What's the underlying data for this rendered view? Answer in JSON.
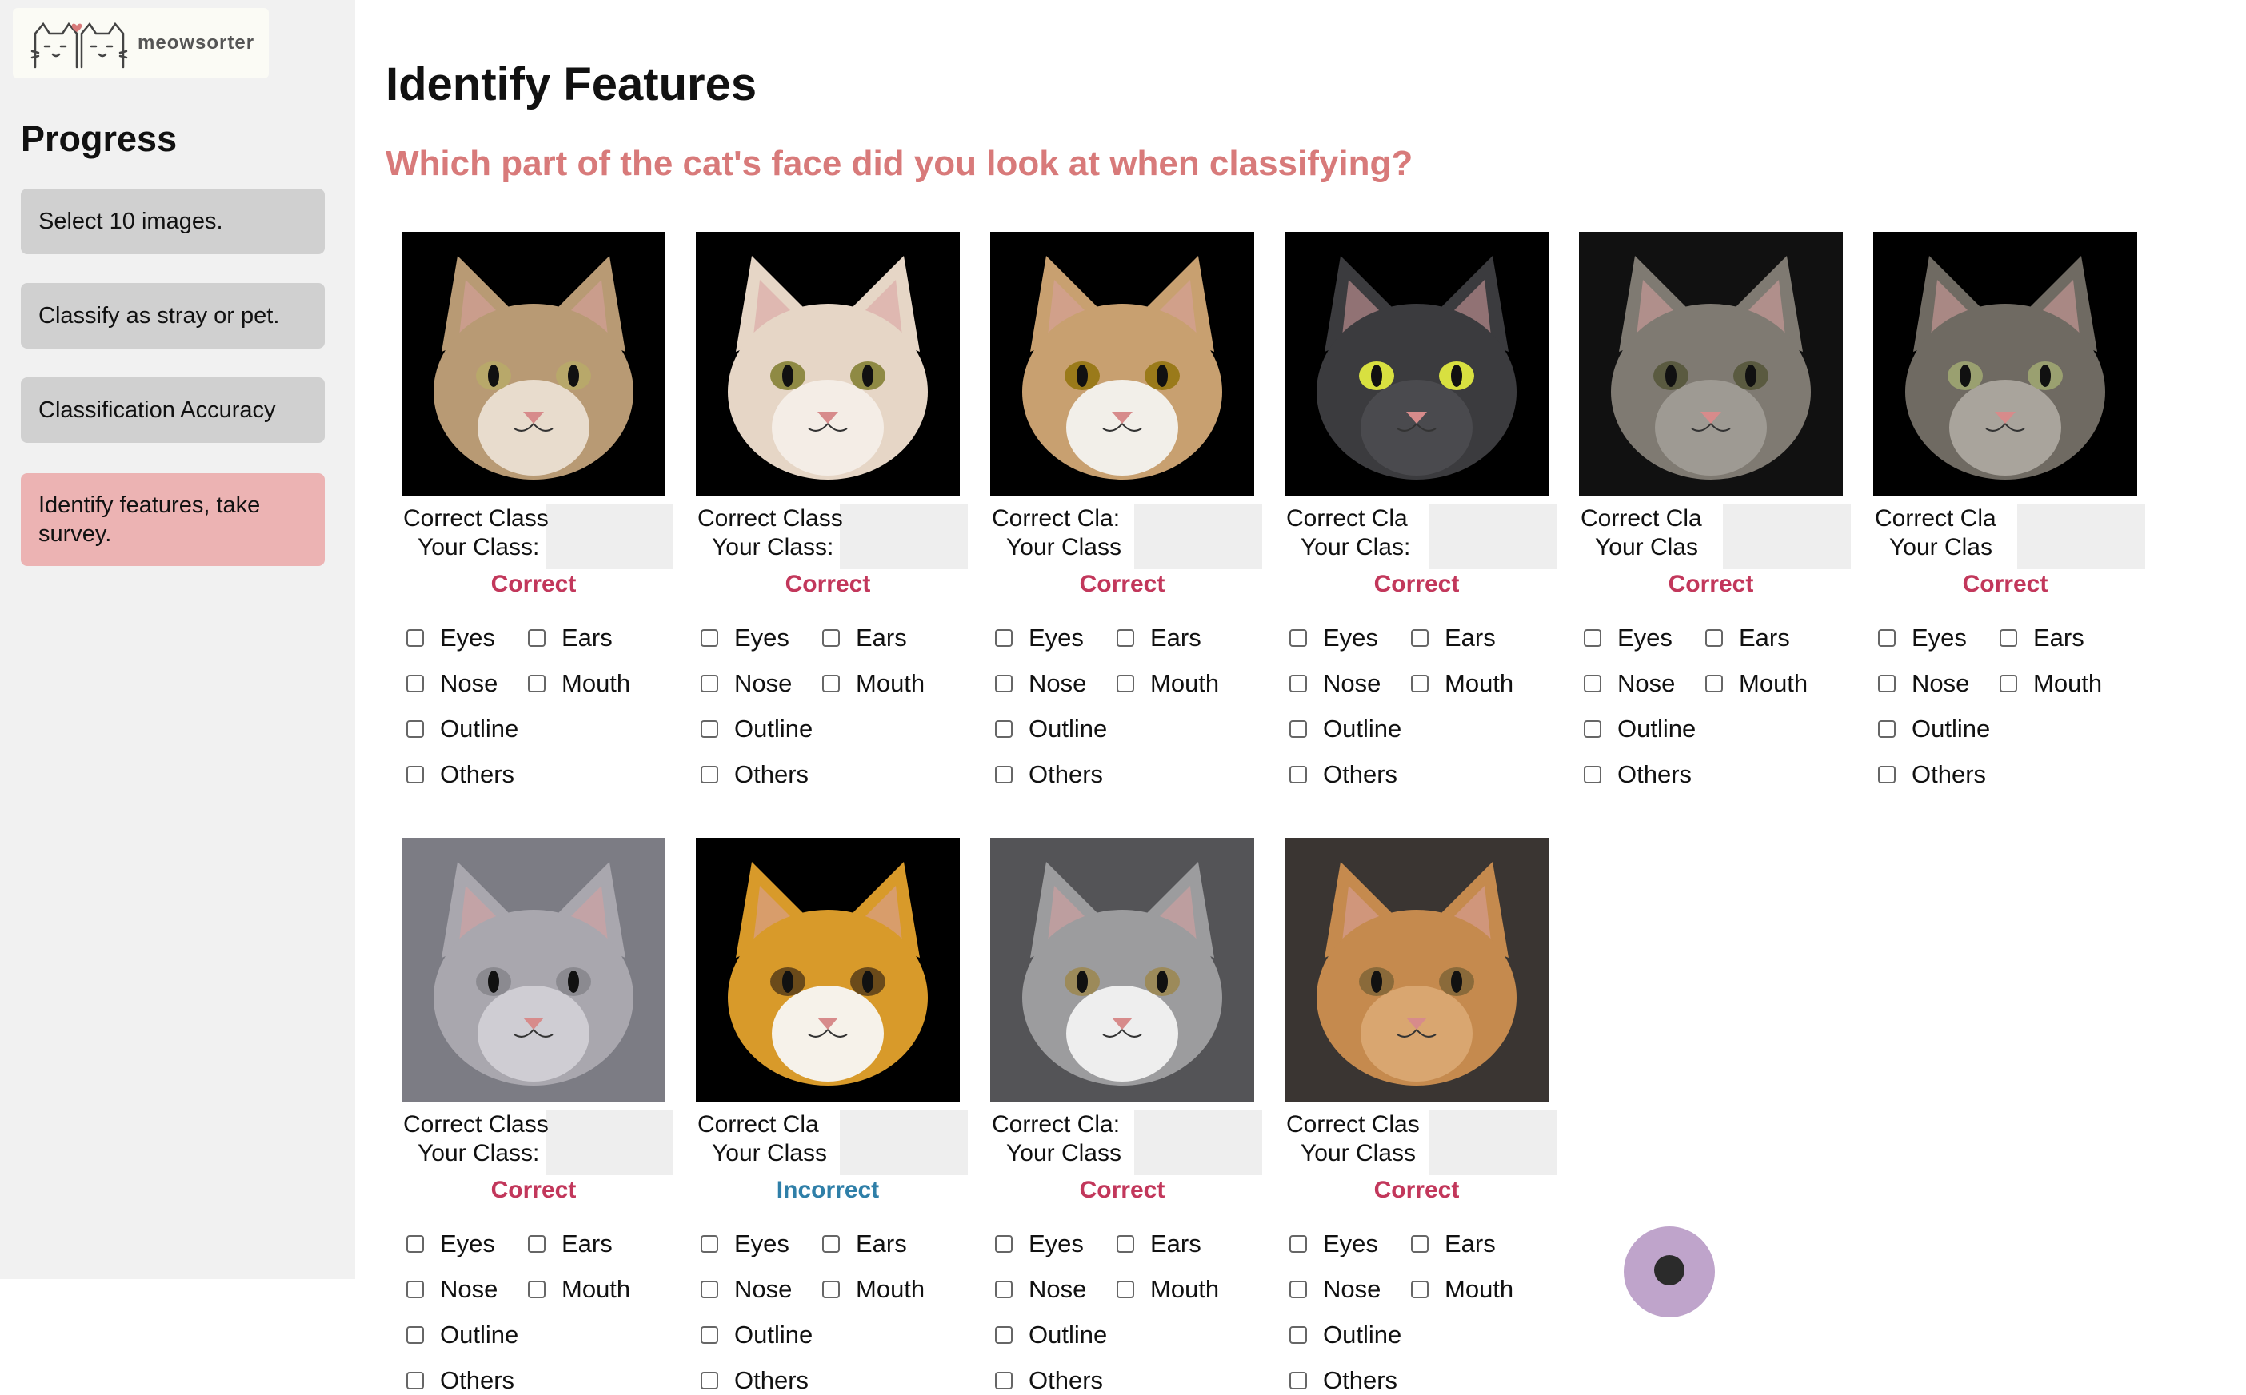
{
  "brand": {
    "name": "meowsorter"
  },
  "sidebar": {
    "title": "Progress",
    "steps": [
      {
        "label": "Select 10 images."
      },
      {
        "label": "Classify as stray or pet."
      },
      {
        "label": "Classification Accuracy"
      },
      {
        "label": "Identify features, take survey.",
        "active": true
      }
    ]
  },
  "page": {
    "title": "Identify Features",
    "question": "Which part of the cat's face did you look at when classifying?"
  },
  "checkbox_labels": {
    "eyes": "Eyes",
    "ears": "Ears",
    "nose": "Nose",
    "mouth": "Mouth",
    "outline": "Outline",
    "others": "Others"
  },
  "cards": [
    {
      "correct_class": "Correct Class",
      "your_class": "Your Class:",
      "result": "Correct"
    },
    {
      "correct_class": "Correct Class",
      "your_class": "Your Class:",
      "result": "Correct"
    },
    {
      "correct_class": "Correct Cla:",
      "your_class": "Your Class",
      "result": "Correct"
    },
    {
      "correct_class": "Correct Cla",
      "your_class": "Your Clas:",
      "result": "Correct"
    },
    {
      "correct_class": "Correct Cla",
      "your_class": "Your Clas",
      "result": "Correct"
    },
    {
      "correct_class": "Correct Cla",
      "your_class": "Your Clas",
      "result": "Correct"
    },
    {
      "correct_class": "Correct Class",
      "your_class": "Your Class:",
      "result": "Correct"
    },
    {
      "correct_class": "Correct Cla",
      "your_class": "Your Class",
      "result": "Incorrect"
    },
    {
      "correct_class": "Correct Cla:",
      "your_class": "Your Class",
      "result": "Correct"
    },
    {
      "correct_class": "Correct Clas",
      "your_class": "Your Class",
      "result": "Correct"
    }
  ],
  "colors": {
    "accent": "#d87a7a",
    "correct": "#c2375b",
    "incorrect": "#2f7fa8",
    "active_step": "#ecb3b3",
    "step": "#d0d0d0",
    "cat_palettes": [
      {
        "bg": "#000000",
        "fur": "#b89a74",
        "patch": "#e8dccd",
        "eye": "#b8a86a"
      },
      {
        "bg": "#000000",
        "fur": "#e6d6c6",
        "patch": "#f4ede6",
        "eye": "#8f8a44"
      },
      {
        "bg": "#000000",
        "fur": "#c8a070",
        "patch": "#f2efe9",
        "eye": "#9a7a1a"
      },
      {
        "bg": "#000000",
        "fur": "#3b3b3e",
        "patch": "#4a4a4e",
        "eye": "#d8e040"
      },
      {
        "bg": "#111111",
        "fur": "#7f7a72",
        "patch": "#9e9a93",
        "eye": "#5a5a40"
      },
      {
        "bg": "#000000",
        "fur": "#6f6a62",
        "patch": "#a9a49c",
        "eye": "#9aa070"
      },
      {
        "bg": "#7c7c84",
        "fur": "#a9a7ae",
        "patch": "#cfcdd3",
        "eye": "#8b8a90"
      },
      {
        "bg": "#000000",
        "fur": "#d89a2a",
        "patch": "#f6f2ea",
        "eye": "#6a4a1a"
      },
      {
        "bg": "#545457",
        "fur": "#9c9c9e",
        "patch": "#eeeeee",
        "eye": "#9c8a5a"
      },
      {
        "bg": "#3a3532",
        "fur": "#c58a4e",
        "patch": "#d9a670",
        "eye": "#8a6a3a"
      }
    ]
  }
}
